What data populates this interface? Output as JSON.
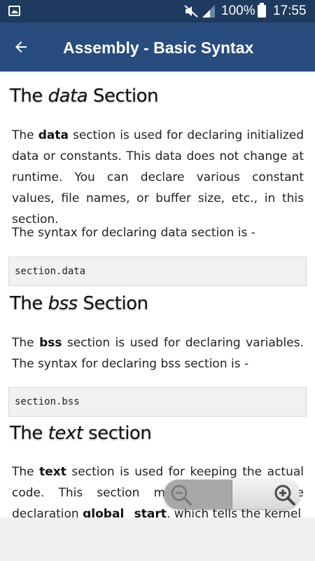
{
  "status_bar": {
    "battery_percent": "100%",
    "time": "17:55",
    "icons": [
      "gallery-icon",
      "mute-icon",
      "signal-icon",
      "battery-icon"
    ]
  },
  "app_bar": {
    "title": "Assembly - Basic Syntax",
    "back_icon": "arrow-left-icon"
  },
  "sections": {
    "data": {
      "heading_pre": "The ",
      "heading_em": "data",
      "heading_post": " Section",
      "p1_pre": "The ",
      "p1_bold": "data",
      "p1_post": " section is used for declaring initialized data or constants. This data does not change at runtime. You can declare various constant values, file names, or buffer size, etc., in this section.",
      "p2": "The syntax for declaring data section is -",
      "code": "section.data"
    },
    "bss": {
      "heading_pre": "The ",
      "heading_em": "bss",
      "heading_post": " Section",
      "p1_pre": "The ",
      "p1_bold": "bss",
      "p1_post": " section is used for declaring variables. The syntax for declaring bss section is -",
      "code": "section.bss"
    },
    "text": {
      "heading_pre": "The ",
      "heading_em": "text",
      "heading_post": " section",
      "p1_pre": "The ",
      "p1_bold": "text",
      "p1_mid": " section is used for keeping the actual code. This section must begin with the declaration ",
      "p1_bold2": "global _start",
      "p1_post": ", which tells the kernel"
    }
  },
  "zoom": {
    "out_icon": "zoom-out-icon",
    "in_icon": "zoom-in-icon"
  },
  "colors": {
    "status_bar": "#1f3a5f",
    "app_bar": "#274c7d",
    "code_bg": "#f1f1f1"
  }
}
